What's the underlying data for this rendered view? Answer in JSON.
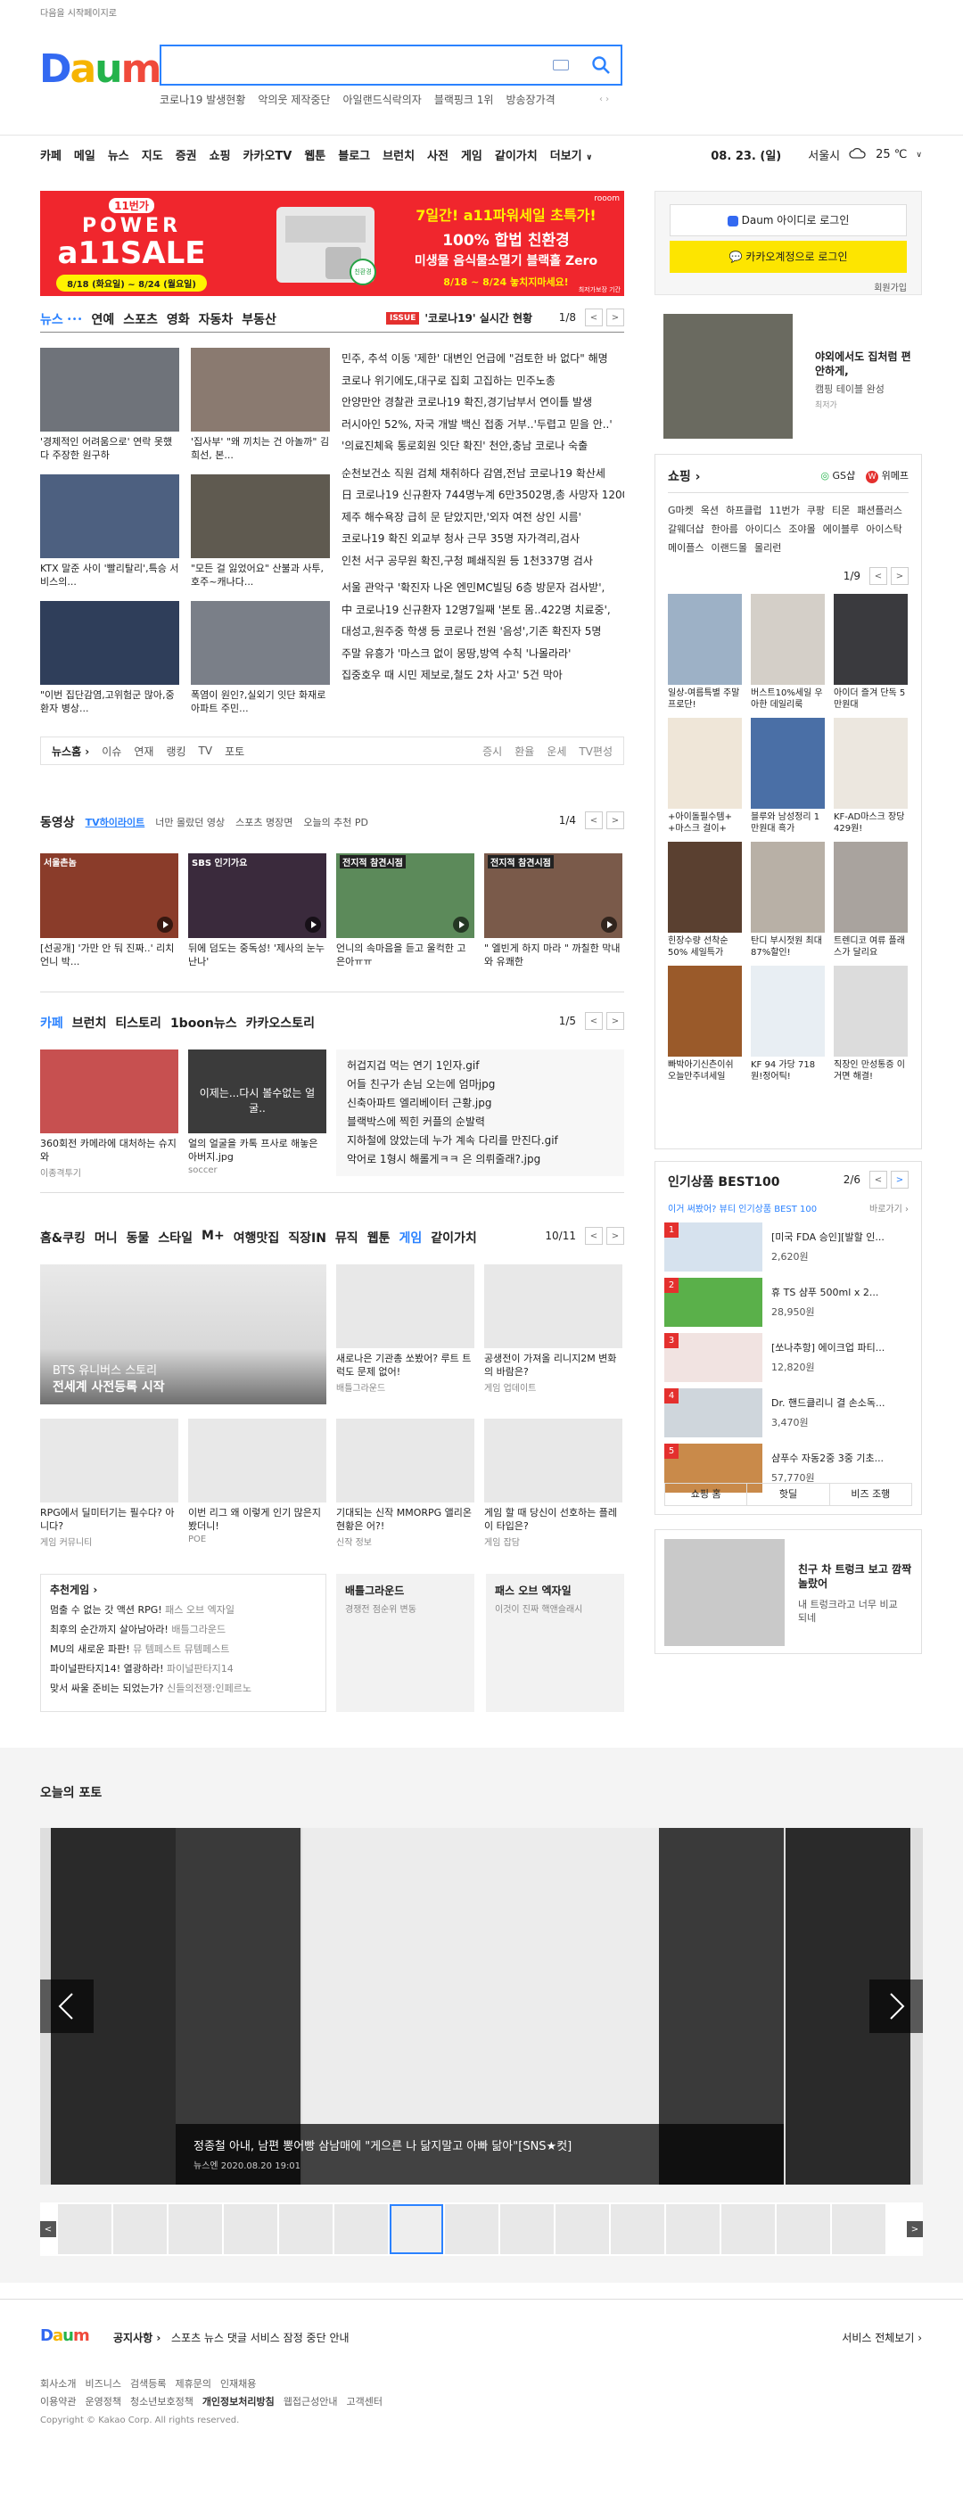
{
  "header": {
    "start_page": "다음을 시작페이지로",
    "logo": "Daum",
    "issues": [
      "코로나19 발생현황",
      "악의웃 제작중단",
      "아일랜드식락의자",
      "블랙핑크 1위",
      "방송장가격"
    ],
    "issue_arrows": "‹ ›"
  },
  "gnb": {
    "items": [
      "카페",
      "메일",
      "뉴스",
      "지도",
      "증권",
      "쇼핑",
      "카카오TV",
      "웹툰",
      "블로그",
      "브런치",
      "사전",
      "게임",
      "같이가치",
      "더보기"
    ],
    "date": "08. 23. (일)",
    "location": "서울시",
    "temp": "25 ℃"
  },
  "ad": {
    "brand": "11번가",
    "title1": "POWER",
    "title2": "a11SALE",
    "date": "8/18 (화요일) ~ 8/24 (월요일)",
    "headline": "7일간! a11파워세일 초특가!",
    "sub1": "100% 합법 친환경",
    "sub2": "미생물 음식물소멸기 블랙홀 Zero",
    "sub3": "8/18 ~ 8/24  놓치지마세요!",
    "tag": "rooom",
    "badge": "친환경",
    "fine": "최저가보장 기간"
  },
  "news": {
    "tabs": [
      "뉴스",
      "연예",
      "스포츠",
      "영화",
      "자동차",
      "부동산"
    ],
    "issue_badge": "ISSUE",
    "issue_title": "'코로나19' 실시간 현황",
    "page": "1/8",
    "thumbs": [
      {
        "cap": "'경제적인 어려움으로' 연락 못했다 주장한 원구하"
      },
      {
        "cap": "'집사부' \"왜 끼치는 건 아놀까\" 김희선, 본..."
      },
      {
        "cap": "KTX 말준 사이 '빨리탈리',특승 서비스의..."
      },
      {
        "cap": "\"모든 걸 잃었어요\" 산불과 사투,호주~캐나다..."
      },
      {
        "cap": "\"이번 집단감염,고위험군 많아,중환자 병상..."
      },
      {
        "cap": "폭염이 원인?,실외기 잇단 화재로 아파트 주민..."
      }
    ],
    "headlines": [
      "민주, 추석 이동 '제한' 대변인 언급에 \"검토한 바 없다\" 해명",
      "코로나 위기에도,대구로 집회 고집하는 민주노총",
      "안양만안 경찰관 코로나19 확진,경기남부서 연이틀 발생",
      "러시아인 52%, 자국 개발 백신 접종 거부..'두렵고 믿을 안..'",
      "'의료진체육 통로회원 잇단 확진' 천안,충남 코로나 숙출",
      "순천보건소 직원 검체 채취하다 감염,전남 코로나19 확산세",
      "日 코로나19 신규환자 744명누계 6만3502명,총 사망자 1200...",
      "제주 해수욕장 급히 문 닫았지만,'외자 여전 상인 시름'",
      "코로나19 확진 외교부 청사 근무 35명 자가격리,검사",
      "인천 서구 공무원 확진,구청 폐쇄직원 등 1천337명 검사",
      "서울 관악구 '확진자 나온 엔민MC빌딩 6층 방문자 검사받',",
      "中 코로나19 신규환자 12명7일째 '본토 몸..422명 치료중',",
      "대성고,원주중 학생 등 코로나 전원 '음성',기존 확진자 5명",
      "주말 유흥가 '마스크 없이 몽땅,방역 수칙 '나몰라라'",
      "집중호우 때 시민 제보로,철도 2차 사고' 5건 막아"
    ],
    "sublinks": [
      "뉴스홈",
      "이슈",
      "연재",
      "랭킹",
      "TV",
      "포토"
    ],
    "right_links": [
      "증시",
      "환율",
      "운세",
      "TV편성"
    ]
  },
  "video": {
    "title": "동영상",
    "tabs": [
      "TV하이라이트",
      "너만 몰랐던 영상",
      "스포츠 명장면",
      "오늘의 추천 PD"
    ],
    "page": "1/4",
    "items": [
      {
        "label": "서울촌놈",
        "cap": "[선공개] '가만 안 둬 진짜..' 리치언니 박..."
      },
      {
        "label": "SBS 인기가요",
        "cap": "뒤에 덤도는 중독성! '제사의 눈누난나'"
      },
      {
        "label": "전지적 참견시점",
        "cap": "언니의 속마음을 듣고 울컥한 고은아ㅠㅠ"
      },
      {
        "label": "전지적 참견시점",
        "cap": "\" 엘빈게 하지 마라 \" 까칠한 막내와 유쾌한"
      }
    ]
  },
  "cafe": {
    "tabs": [
      "카페",
      "브런치",
      "티스토리",
      "1boon뉴스",
      "카카오스토리"
    ],
    "page": "1/5",
    "thumbs": [
      {
        "cap": "360회전 카메라에 대처하는 슈지와",
        "src": "이종격투기"
      },
      {
        "cap": "얼의 얼굴을 카톡 프사로 해놓은 아버지.jpg",
        "src": "soccer"
      }
    ],
    "thumb_overlay": "이제는...다시 볼수없는 얼굴..",
    "list": [
      "허겁지겁 먹는 연기 1인자.gif",
      "어들 친구가 손님 오는에 엄마jpg",
      "신축아파트 엘리베이터 근황.jpg",
      "블랙박스에 찍힌 커플의 순발력",
      "지하철에 앉았는데 누가 계속 다리를 만진다.gif",
      "악어로 1형시 해롤게ㅋㅋ 은 의뤼줄래?.jpg"
    ]
  },
  "interest": {
    "tabs": [
      "홈&쿠킹",
      "머니",
      "동물",
      "스타일",
      "M+",
      "여행맛집",
      "직장IN",
      "뮤직",
      "웹툰",
      "게임",
      "같이가치"
    ],
    "page": "10/11",
    "big": {
      "line1": "BTS 유니버스 스토리",
      "line2": "전세계 사전등록 시작"
    },
    "cards": [
      {
        "t": "새로나은 기관총 쏘봤어? 루트 트럭도 문제 없어!",
        "s": "배틀그라운드"
      },
      {
        "t": "공생전이 가져올 리니지2M 변화의 바람은?",
        "s": "게임 업데이트"
      },
      {
        "t": "RPG에서 딜미터기는 필수다? 아니다?",
        "s": "게임 커뮤니티"
      },
      {
        "t": "이번 리그 왜 이렇게 인기 많은지 봤더니!",
        "s": "POE"
      },
      {
        "t": "기대되는 신작 MMORPG 앨리온 현황은 어?!",
        "s": "신작 정보"
      },
      {
        "t": "게임 할 때 당신이 선호하는 플레이 타입은?",
        "s": "게임 잡담"
      }
    ],
    "rec_title": "추천게임 ›",
    "rec": [
      {
        "t": "멈출 수 없는 갓 액션 RPG!",
        "s": "패스 오브 엑자일"
      },
      {
        "t": "최후의 순간까지 살아남아라!",
        "s": "배틀그라운드"
      },
      {
        "t": "MU의 새로운 파판!",
        "s": "뮤 템페스트 뮤템페스트"
      },
      {
        "t": "파이널판타지14! 열광하라!",
        "s": "파이널판타지14"
      },
      {
        "t": "맞서 싸울 준비는 되었는가?",
        "s": "신들의전쟁:인페르노"
      }
    ],
    "b1": {
      "t": "배틀그라운드",
      "s": "경쟁전 점순위 변동"
    },
    "b2": {
      "t": "패스 오브 엑자일",
      "s": "이것이 진짜 핵앤슬래시"
    }
  },
  "right": {
    "login_daum": "Daum 아이디로 로그인",
    "login_kakao": "카카오계정으로 로그인",
    "join": "회원가입",
    "ad_title": "야외에서도 집처럼 편안하게,",
    "ad_sub": "캠핑 테이블 완성",
    "ad_src": "최저가",
    "shopping_title": "쇼핑 ›",
    "shop_brands": [
      "GS샵",
      "위메프"
    ],
    "shop_cats": [
      "G마켓",
      "옥션",
      "하프클럽",
      "11번가",
      "쿠팡",
      "티몬",
      "패션플러스",
      "갈웨더샵",
      "한아름",
      "아이디스",
      "조야몰",
      "에이블루",
      "아이스탁",
      "메이플스",
      "이랜드몰",
      "몰리런"
    ],
    "shop_page": "1/9",
    "shop_items": [
      "일상-여름특별 주말프로단!",
      "버스트10%세일 우아한 데일리룩",
      "아이더 즐겨 단독 5만원대",
      "+아이돌필수템+ +마스크 걸이+",
      "블루와 남성정리 1만원대 흑가",
      "KF-AD마스크 장당 429원!",
      "힌장수량 선착순 50% 세일특가",
      "탄디 부시젓원 최대87%할인!",
      "트렌디코 여류 플래스가 달리요",
      "빠박아기신츤이쉬 오늘만주녀세일",
      "KF 94 가당 718원!정어틱!",
      "직장인 만성통증 이거면 해결!"
    ],
    "best_title": "인기상품 BEST100",
    "best_page": "2/6",
    "best_sub": "이거 써봤어? 뷰티 인기상품 BEST 100",
    "best_more": "바로가기 ›",
    "best_items": [
      {
        "r": "1",
        "n": "[미국 FDA 승인][발할 인...",
        "p": "2,620원"
      },
      {
        "r": "2",
        "n": "휴 TS 샴푸 500ml x 2...",
        "p": "28,950원"
      },
      {
        "r": "3",
        "n": "[쏘나추항] 에이크업 파티...",
        "p": "12,820원"
      },
      {
        "r": "4",
        "n": "Dr. 핸드클리니 결 손소독...",
        "p": "3,470원"
      },
      {
        "r": "5",
        "n": "샴푸수 자동2중 3중 기초...",
        "p": "57,770원"
      }
    ],
    "best_tabs": [
      "쇼핑 홈",
      "핫딜",
      "비즈 조행"
    ],
    "ad2_title": "친구 차 트렁크 보고 깜짝 놀랐어",
    "ad2_sub": "내 트렁크라고 너무 비교되네"
  },
  "photo": {
    "title": "오늘의 포토",
    "caption": "정종철 아내, 남편 뽕어빵 삼남매에 \"게으른 나 닮지말고 아빠 닮아\"[SNS★컷]",
    "meta": "뉴스엔  2020.08.20 19:01"
  },
  "footer": {
    "notice_label": "공지사항 ›",
    "notice": "스포츠 뉴스 댓글 서비스 잠정 중단 안내",
    "all_services": "서비스 전체보기 ›",
    "links1": [
      "회사소개",
      "비즈니스",
      "검색등록",
      "제휴문의",
      "인재채용"
    ],
    "links2": [
      "이용약관",
      "운영정책",
      "청소년보호정책",
      "개인정보처리방침",
      "웹접근성안내",
      "고객센터"
    ],
    "copyright": "Copyright © Kakao Corp. All rights reserved."
  },
  "colors": {
    "accent": "#2b82ff",
    "daum_blue": "#3369f1",
    "red": "#e4302e",
    "kakao_yellow": "#fde500"
  }
}
